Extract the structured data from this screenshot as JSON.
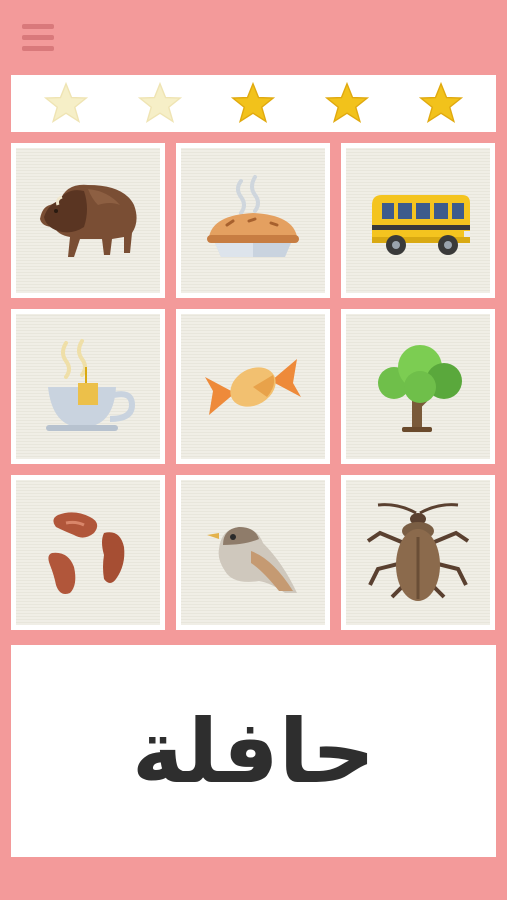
{
  "menu": {
    "icon": "hamburger-menu-icon"
  },
  "stars": {
    "total": 5,
    "filled": 3,
    "colors": {
      "filled": "#f2c21b",
      "empty": "#f6efc7"
    }
  },
  "tiles": [
    {
      "icon": "bison-icon"
    },
    {
      "icon": "pie-icon"
    },
    {
      "icon": "bus-icon"
    },
    {
      "icon": "tea-cup-icon"
    },
    {
      "icon": "candy-icon"
    },
    {
      "icon": "tree-icon"
    },
    {
      "icon": "beans-icon"
    },
    {
      "icon": "sparrow-icon"
    },
    {
      "icon": "cockroach-icon"
    }
  ],
  "prompt": {
    "word": "حافلة"
  },
  "colors": {
    "background": "#f39a9a",
    "panel": "#ffffff",
    "text": "#2e2e2e"
  }
}
